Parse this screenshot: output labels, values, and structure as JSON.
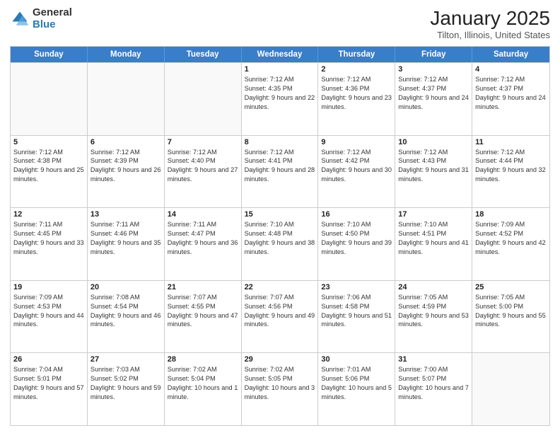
{
  "header": {
    "logo_line1": "General",
    "logo_line2": "Blue",
    "month_year": "January 2025",
    "location": "Tilton, Illinois, United States"
  },
  "weekdays": [
    "Sunday",
    "Monday",
    "Tuesday",
    "Wednesday",
    "Thursday",
    "Friday",
    "Saturday"
  ],
  "weeks": [
    [
      {
        "day": "",
        "info": ""
      },
      {
        "day": "",
        "info": ""
      },
      {
        "day": "",
        "info": ""
      },
      {
        "day": "1",
        "info": "Sunrise: 7:12 AM\nSunset: 4:35 PM\nDaylight: 9 hours and 22 minutes."
      },
      {
        "day": "2",
        "info": "Sunrise: 7:12 AM\nSunset: 4:36 PM\nDaylight: 9 hours and 23 minutes."
      },
      {
        "day": "3",
        "info": "Sunrise: 7:12 AM\nSunset: 4:37 PM\nDaylight: 9 hours and 24 minutes."
      },
      {
        "day": "4",
        "info": "Sunrise: 7:12 AM\nSunset: 4:37 PM\nDaylight: 9 hours and 24 minutes."
      }
    ],
    [
      {
        "day": "5",
        "info": "Sunrise: 7:12 AM\nSunset: 4:38 PM\nDaylight: 9 hours and 25 minutes."
      },
      {
        "day": "6",
        "info": "Sunrise: 7:12 AM\nSunset: 4:39 PM\nDaylight: 9 hours and 26 minutes."
      },
      {
        "day": "7",
        "info": "Sunrise: 7:12 AM\nSunset: 4:40 PM\nDaylight: 9 hours and 27 minutes."
      },
      {
        "day": "8",
        "info": "Sunrise: 7:12 AM\nSunset: 4:41 PM\nDaylight: 9 hours and 28 minutes."
      },
      {
        "day": "9",
        "info": "Sunrise: 7:12 AM\nSunset: 4:42 PM\nDaylight: 9 hours and 30 minutes."
      },
      {
        "day": "10",
        "info": "Sunrise: 7:12 AM\nSunset: 4:43 PM\nDaylight: 9 hours and 31 minutes."
      },
      {
        "day": "11",
        "info": "Sunrise: 7:12 AM\nSunset: 4:44 PM\nDaylight: 9 hours and 32 minutes."
      }
    ],
    [
      {
        "day": "12",
        "info": "Sunrise: 7:11 AM\nSunset: 4:45 PM\nDaylight: 9 hours and 33 minutes."
      },
      {
        "day": "13",
        "info": "Sunrise: 7:11 AM\nSunset: 4:46 PM\nDaylight: 9 hours and 35 minutes."
      },
      {
        "day": "14",
        "info": "Sunrise: 7:11 AM\nSunset: 4:47 PM\nDaylight: 9 hours and 36 minutes."
      },
      {
        "day": "15",
        "info": "Sunrise: 7:10 AM\nSunset: 4:48 PM\nDaylight: 9 hours and 38 minutes."
      },
      {
        "day": "16",
        "info": "Sunrise: 7:10 AM\nSunset: 4:50 PM\nDaylight: 9 hours and 39 minutes."
      },
      {
        "day": "17",
        "info": "Sunrise: 7:10 AM\nSunset: 4:51 PM\nDaylight: 9 hours and 41 minutes."
      },
      {
        "day": "18",
        "info": "Sunrise: 7:09 AM\nSunset: 4:52 PM\nDaylight: 9 hours and 42 minutes."
      }
    ],
    [
      {
        "day": "19",
        "info": "Sunrise: 7:09 AM\nSunset: 4:53 PM\nDaylight: 9 hours and 44 minutes."
      },
      {
        "day": "20",
        "info": "Sunrise: 7:08 AM\nSunset: 4:54 PM\nDaylight: 9 hours and 46 minutes."
      },
      {
        "day": "21",
        "info": "Sunrise: 7:07 AM\nSunset: 4:55 PM\nDaylight: 9 hours and 47 minutes."
      },
      {
        "day": "22",
        "info": "Sunrise: 7:07 AM\nSunset: 4:56 PM\nDaylight: 9 hours and 49 minutes."
      },
      {
        "day": "23",
        "info": "Sunrise: 7:06 AM\nSunset: 4:58 PM\nDaylight: 9 hours and 51 minutes."
      },
      {
        "day": "24",
        "info": "Sunrise: 7:05 AM\nSunset: 4:59 PM\nDaylight: 9 hours and 53 minutes."
      },
      {
        "day": "25",
        "info": "Sunrise: 7:05 AM\nSunset: 5:00 PM\nDaylight: 9 hours and 55 minutes."
      }
    ],
    [
      {
        "day": "26",
        "info": "Sunrise: 7:04 AM\nSunset: 5:01 PM\nDaylight: 9 hours and 57 minutes."
      },
      {
        "day": "27",
        "info": "Sunrise: 7:03 AM\nSunset: 5:02 PM\nDaylight: 9 hours and 59 minutes."
      },
      {
        "day": "28",
        "info": "Sunrise: 7:02 AM\nSunset: 5:04 PM\nDaylight: 10 hours and 1 minute."
      },
      {
        "day": "29",
        "info": "Sunrise: 7:02 AM\nSunset: 5:05 PM\nDaylight: 10 hours and 3 minutes."
      },
      {
        "day": "30",
        "info": "Sunrise: 7:01 AM\nSunset: 5:06 PM\nDaylight: 10 hours and 5 minutes."
      },
      {
        "day": "31",
        "info": "Sunrise: 7:00 AM\nSunset: 5:07 PM\nDaylight: 10 hours and 7 minutes."
      },
      {
        "day": "",
        "info": ""
      }
    ]
  ]
}
